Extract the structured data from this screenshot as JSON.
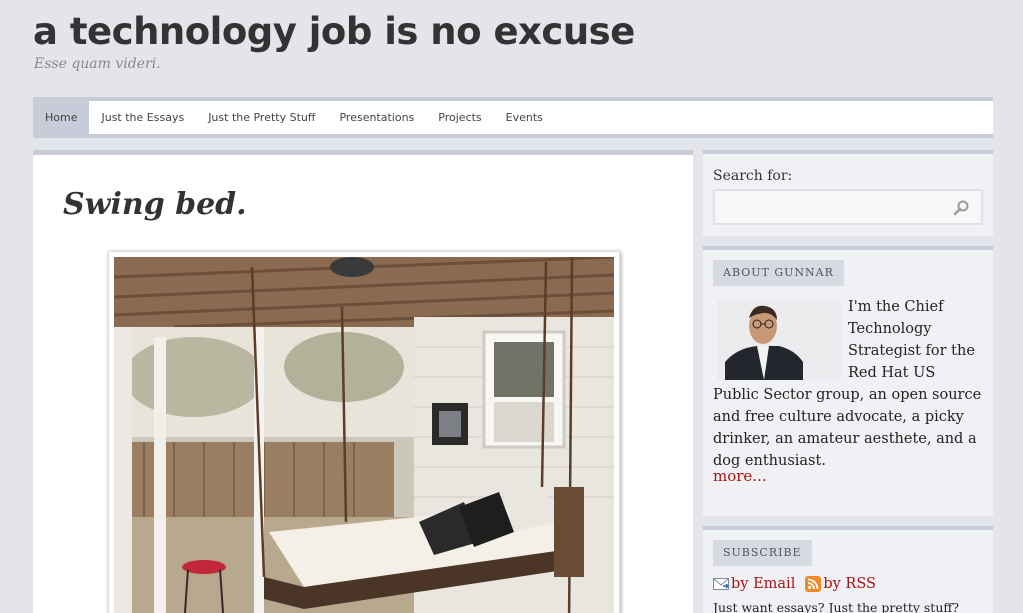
{
  "site": {
    "title": "a technology job is no excuse",
    "tagline": "Esse quam videri."
  },
  "nav": {
    "items": [
      {
        "label": "Home",
        "active": true
      },
      {
        "label": "Just the Essays",
        "active": false
      },
      {
        "label": "Just the Pretty Stuff",
        "active": false
      },
      {
        "label": "Presentations",
        "active": false
      },
      {
        "label": "Projects",
        "active": false
      },
      {
        "label": "Events",
        "active": false
      }
    ]
  },
  "post": {
    "title": "Swing bed."
  },
  "sidebar": {
    "search": {
      "label": "Search for:",
      "value": "",
      "placeholder": "",
      "icon": "magnifier-icon"
    },
    "about": {
      "heading": "ABOUT GUNNAR",
      "text": "I'm the Chief Technology Strategist for the Red Hat US Public Sector group, an open source and free culture advocate, a picky drinker, an amateur aesthete, and a dog enthusiast.",
      "more_label": "more..."
    },
    "subscribe": {
      "heading": "SUBSCRIBE",
      "email_label": "by Email",
      "rss_label": "by RSS",
      "note": "Just want essays? Just the pretty stuff?"
    }
  },
  "colors": {
    "background": "#e4e5ea",
    "accent_bar": "#c8ccd8",
    "link": "#aa1111"
  }
}
